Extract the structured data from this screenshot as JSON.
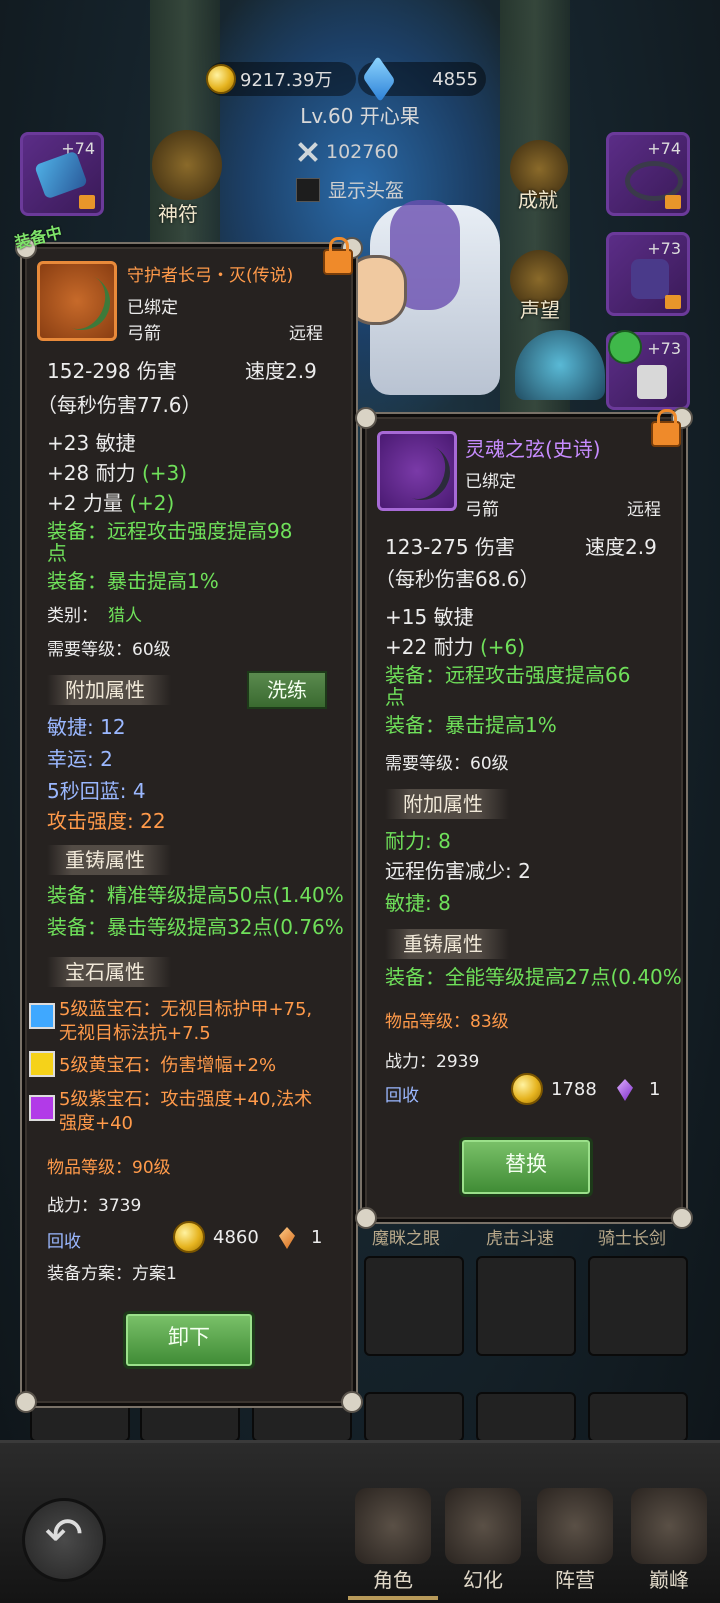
{
  "header": {
    "gold": "9217.39万",
    "gems": "4855",
    "level_name": "Lv.60 开心果",
    "power": "102760",
    "show_helmet": "显示头盔"
  },
  "side_left": {
    "slot_top_plus": "+74",
    "rune_label": "神符"
  },
  "side_right": {
    "slots": [
      {
        "plus": "+74"
      },
      {
        "plus": "+73"
      },
      {
        "plus": "+73"
      }
    ],
    "achievement_label": "成就",
    "reputation_label": "声望"
  },
  "equipped_tag": "装备中",
  "left_item": {
    "name": "守护者长弓・灭(传说)",
    "bound": "已绑定",
    "type": "弓箭",
    "range": "远程",
    "damage": "152-298 伤害",
    "speed": "速度2.9",
    "dps": "（每秒伤害77.6）",
    "stats": [
      {
        "base": "+23 敏捷",
        "bonus": ""
      },
      {
        "base": "+28 耐力",
        "bonus": "(+3)"
      },
      {
        "base": "+2 力量",
        "bonus": "(+2)"
      }
    ],
    "equip1_line1": "装备：远程攻击强度提高98",
    "equip1_line2": "点",
    "equip2": "装备：暴击提高1%",
    "class_label": "类别：",
    "class_value": "猎人",
    "req_level": "需要等级：60级",
    "extra_title": "附加属性",
    "wash_button": "洗练",
    "extra": [
      "敏捷: 12",
      "幸运: 2",
      "5秒回蓝: 4",
      "攻击强度: 22"
    ],
    "reforge_title": "重铸属性",
    "reforge": [
      "装备：精准等级提高50点(1.40%",
      "装备：暴击等级提高32点(0.76%"
    ],
    "gem_title": "宝石属性",
    "gems": [
      {
        "line1": "5级蓝宝石：无视目标护甲+75,",
        "line2": "无视目标法抗+7.5",
        "color": "#3fa8ff"
      },
      {
        "line1": "5级黄宝石：伤害增幅+2%",
        "line2": "",
        "color": "#f5d21a"
      },
      {
        "line1": "5级紫宝石：攻击强度+40,法术",
        "line2": "强度+40",
        "color": "#b23ae8"
      }
    ],
    "item_level": "物品等级：90级",
    "power": "战力：3739",
    "recycle": "回收",
    "recycle_gold": "4860",
    "recycle_crystal": "1",
    "plan": "装备方案：方案1",
    "unequip_button": "卸下"
  },
  "right_item": {
    "name": "灵魂之弦(史诗)",
    "bound": "已绑定",
    "type": "弓箭",
    "range": "远程",
    "damage": "123-275 伤害",
    "speed": "速度2.9",
    "dps": "（每秒伤害68.6）",
    "stats": [
      {
        "base": "+15 敏捷",
        "bonus": ""
      },
      {
        "base": "+22 耐力",
        "bonus": "(+6)"
      }
    ],
    "equip1_line1": "装备：远程攻击强度提高66",
    "equip1_line2": "点",
    "equip2": "装备：暴击提高1%",
    "req_level": "需要等级：60级",
    "extra_title": "附加属性",
    "extra": [
      {
        "text": "耐力: 8",
        "color": "g"
      },
      {
        "text": "远程伤害减少: 2",
        "color": "w"
      },
      {
        "text": "敏捷: 8",
        "color": "g"
      }
    ],
    "reforge_title": "重铸属性",
    "reforge": [
      "装备：全能等级提高27点(0.40%"
    ],
    "item_level": "物品等级：83级",
    "power": "战力：2939",
    "recycle": "回收",
    "recycle_gold": "1788",
    "recycle_crystal": "1",
    "replace_button": "替换"
  },
  "under_labels": [
    "魔眯之眼",
    "虎击斗速",
    "骑士长剑"
  ],
  "bottom_nav": [
    "角色",
    "幻化",
    "阵营",
    "巅峰"
  ],
  "colors": {
    "legendary": "#ff9a4a",
    "epic": "#c78cff",
    "green_text": "#6fe05a"
  }
}
